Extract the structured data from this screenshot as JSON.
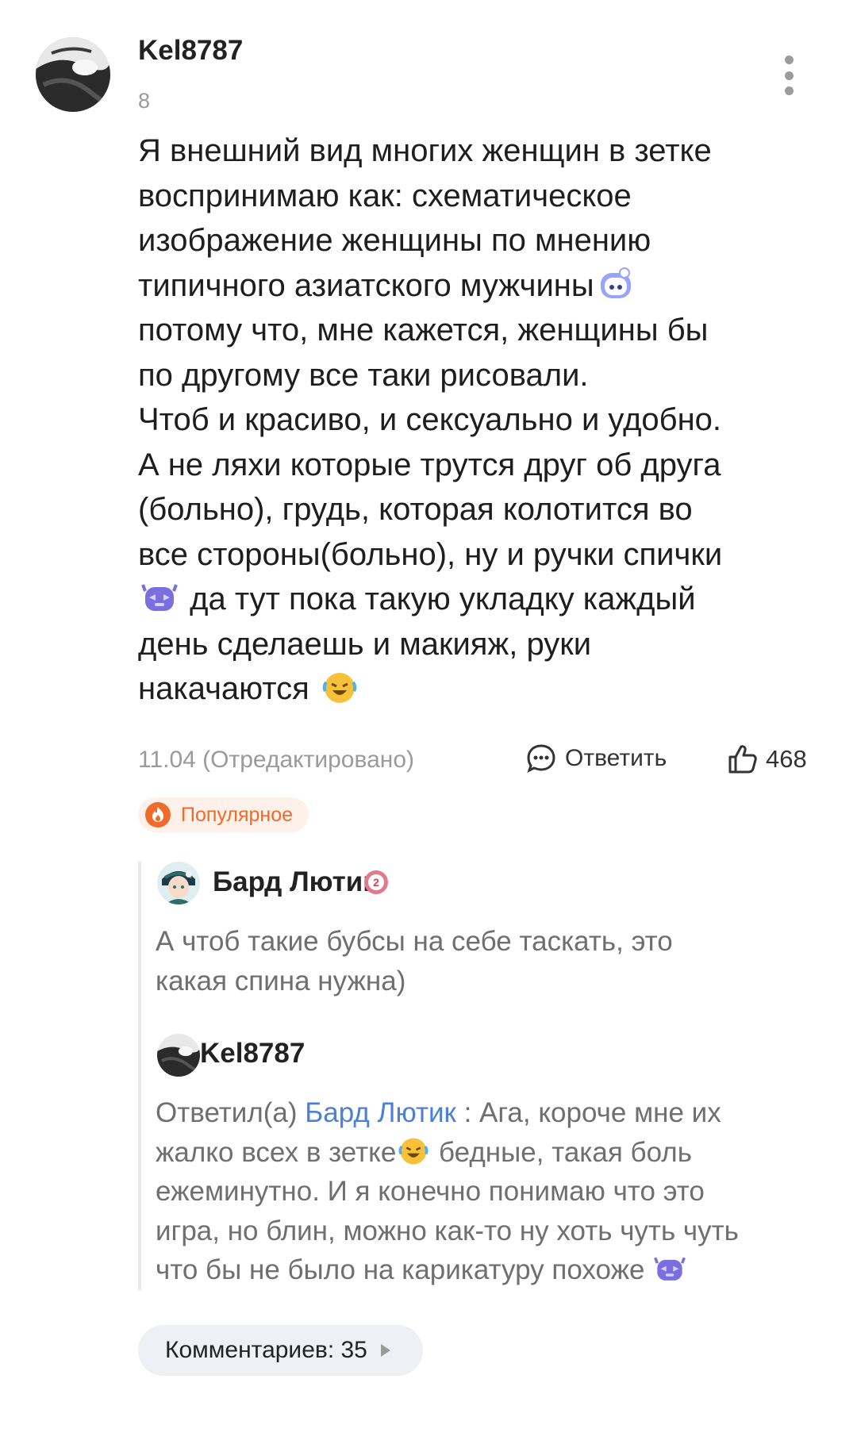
{
  "comment": {
    "username": "Kel8787",
    "level": "8",
    "body_lines": [
      "Я внешний вид многих женщин в зетке",
      "воспринимаю как: схематическое",
      "изображение женщины по мнению",
      "типичного азиатского мужчины",
      "потому что, мне кажется, женщины бы",
      "по другому все таки рисовали.",
      "Чтоб и красиво, и сексуально и удобно.",
      "А не ляхи которые трутся друг об друга",
      "(больно), грудь, которая колотится во",
      "все стороны(больно), ну и ручки спички",
      "да тут пока такую укладку каждый",
      "день сделаешь и макияж, руки",
      "накачаются"
    ],
    "date": "11.04 (Отредактировано)",
    "reply_label": "Ответить",
    "likes": "468",
    "popular_label": "Популярное"
  },
  "replies": [
    {
      "username": "Бард Лютик",
      "badge": "2",
      "text_lines": [
        "А чтоб такие бубсы на себе таскать, это",
        "какая спина нужна)"
      ]
    },
    {
      "username": "Kel8787",
      "reply_prefix": "Ответил(а)",
      "mention": "Бард Лютик",
      "text_first": ": Ага, короче мне их",
      "text_lines": [
        "жалко всех в зетке",
        "бедные, такая боль",
        "ежеминутно. И я конечно понимаю что это",
        "игра, но блин, можно как-то ну хоть чуть чуть",
        "что бы не было на карикатуру похоже"
      ]
    }
  ],
  "comments_count_label": "Комментариев: 35",
  "colors": {
    "accent_orange": "#ef6a2b",
    "mention_blue": "#4c7fd6",
    "muted_gray": "#9a9a9a"
  }
}
